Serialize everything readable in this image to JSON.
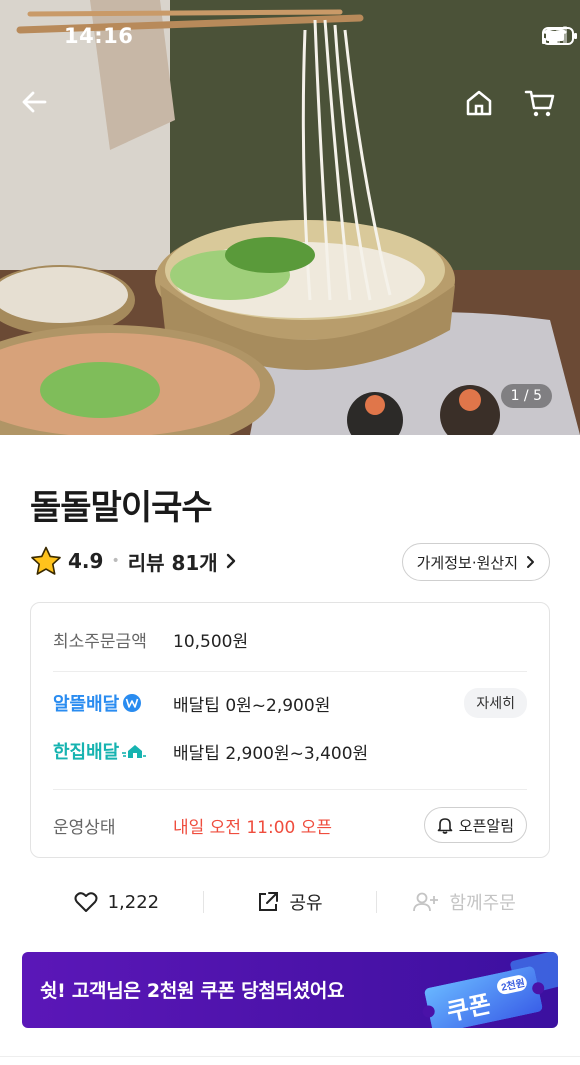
{
  "status_bar": {
    "time": "14:16"
  },
  "hero": {
    "counter": "1 / 5"
  },
  "store": {
    "name": "돌돌말이국수",
    "rating": "4.9",
    "review_label": "리뷰 81개",
    "info_button": "가게정보·원산지"
  },
  "details": {
    "min_order_label": "최소주문금액",
    "min_order_value": "10,500원",
    "delivery_saver_brand": "알뜰배달",
    "delivery_saver_tip": "배달팁 0원~2,900원",
    "detail_button": "자세히",
    "delivery_single_brand": "한집배달",
    "delivery_single_tip": "배달팁 2,900원~3,400원",
    "status_label": "운영상태",
    "status_value": "내일 오전 11:00 오픈",
    "alarm_button": "오픈알림"
  },
  "actions": {
    "likes": "1,222",
    "share": "공유",
    "group_order": "함께주문"
  },
  "banner": {
    "text": "쉿! 고객님은 2천원 쿠폰 당첨되셨어요",
    "coupon_word": "쿠폰",
    "coupon_amount": "2천원"
  },
  "colors": {
    "accent_red": "#ef4d3e",
    "banner_purple": "#5b17b8",
    "brand_blue": "#2a8cf0",
    "brand_teal": "#16b3b0"
  },
  "icons": [
    "back-arrow-icon",
    "home-icon",
    "cart-icon",
    "star-icon",
    "chevron-right-icon",
    "won-icon",
    "house-speed-icon",
    "bell-icon",
    "heart-icon",
    "share-icon",
    "add-person-icon"
  ]
}
